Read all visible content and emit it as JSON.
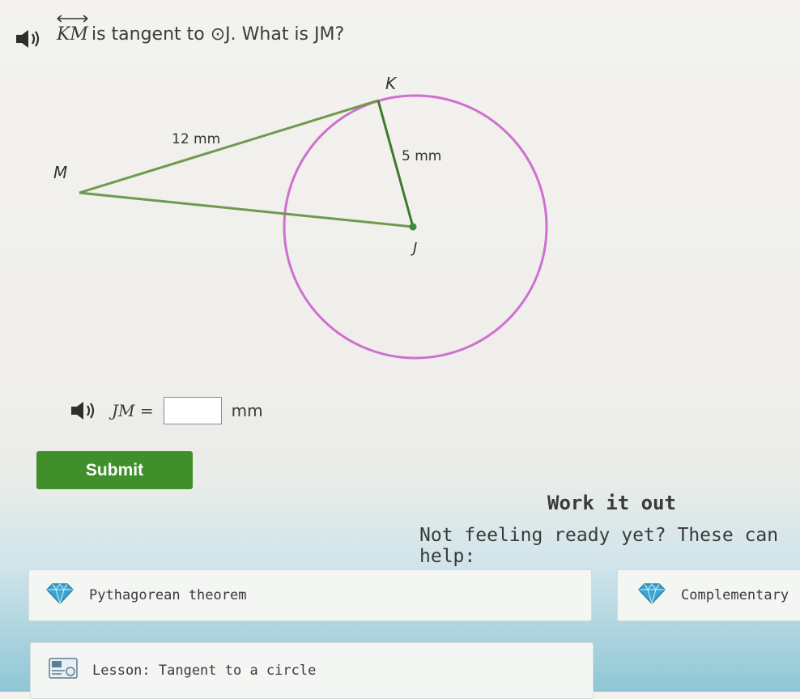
{
  "question": {
    "line": "KM",
    "text_rest": " is tangent to ⊙J. What is JM?"
  },
  "diagram": {
    "label_K": "K",
    "label_M": "M",
    "label_J": "J",
    "label_KM_length": "12 mm",
    "label_KJ_length": "5 mm",
    "colors": {
      "circle": "#cf6fd2",
      "segments": "#6f9a4e",
      "point": "#3e8a3a"
    }
  },
  "answer": {
    "label": "JM =",
    "value": "",
    "unit": "mm"
  },
  "submit": {
    "label": "Submit"
  },
  "work": {
    "title": "Work it out",
    "subtitle": "Not feeling ready yet? These can help:"
  },
  "help": {
    "items": [
      {
        "label": "Pythagorean theorem",
        "icon": "diamond-icon"
      },
      {
        "label": "Complementary",
        "icon": "diamond-icon"
      },
      {
        "label": "Lesson: Tangent to a circle",
        "icon": "lesson-icon"
      }
    ]
  },
  "colors": {
    "submit_bg": "#3f8f2a",
    "gem": "#3aa6d0"
  }
}
